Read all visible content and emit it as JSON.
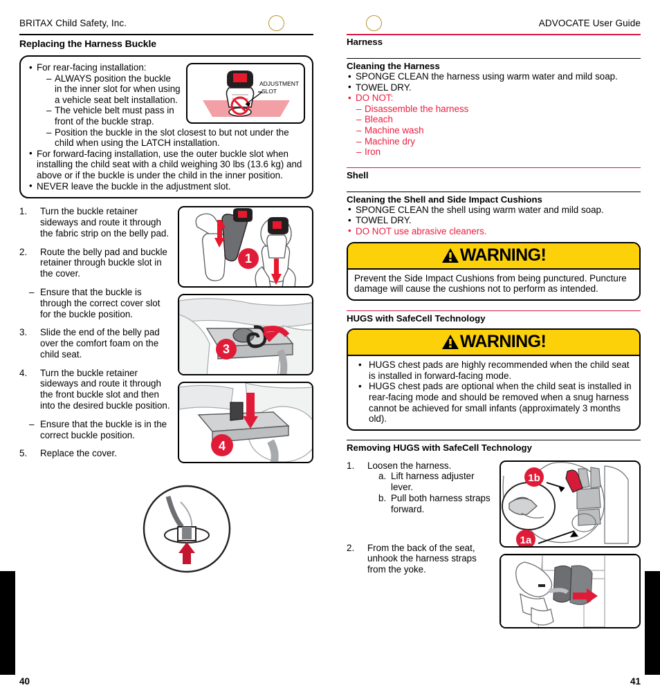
{
  "meta": {
    "accent_red": "#ed1b3c",
    "rule_red": "#d8173f",
    "warning_yellow": "#fcd10a",
    "badge_red": "#e01b38",
    "logo_gold": "#b8932c"
  },
  "left_page": {
    "running_head": "BRITAX Child Safety, Inc.",
    "logo_icon": "britax-circle-logo",
    "section_title": "Replacing the Harness Buckle",
    "folio": "40",
    "callout": {
      "items": [
        {
          "type": "bullet",
          "text": "For rear-facing installation:",
          "sub": [
            "ALWAYS position the buckle in the inner slot for when using a vehicle seat belt installation.",
            "The vehicle belt must pass in front of the buckle strap.",
            "Position the buckle in the slot closest to but not under the child when using the LATCH installation."
          ]
        },
        {
          "type": "bullet",
          "text": "For forward-facing installation, use the outer buckle slot when installing the child seat with a child weighing 30 lbs (13.6 kg) and above or if the buckle is under the child in the inner position.",
          "sub": []
        },
        {
          "type": "bullet",
          "text": "NEVER leave the buckle in the adjustment slot.",
          "sub": []
        }
      ],
      "figure": {
        "name": "adjustment-slot-figure",
        "label_line1": "ADJUSTMENT",
        "label_line2": "SLOT"
      }
    },
    "steps": [
      {
        "num": "1.",
        "text": "Turn the buckle retainer sideways and route it through the fabric strip on the belly pad."
      },
      {
        "num": "2.",
        "text": "Route the belly pad and buckle retainer through buckle slot in the cover."
      },
      {
        "num": "–",
        "text": "Ensure that the buckle is through the correct cover slot for the buckle position."
      },
      {
        "num": "3.",
        "text": "Slide the end of the belly pad over the comfort foam on the child seat."
      },
      {
        "num": "4.",
        "text": "Turn the buckle retainer sideways and route it through the front buckle slot and then into the desired buckle position."
      },
      {
        "num": "–",
        "text": "Ensure that the buckle is in the correct buckle position."
      },
      {
        "num": "5.",
        "text": "Replace the cover."
      }
    ],
    "figures": [
      {
        "name": "figure-step-1",
        "badge": "1"
      },
      {
        "name": "figure-step-3",
        "badge": "3"
      },
      {
        "name": "figure-step-4",
        "badge": "4"
      }
    ]
  },
  "right_page": {
    "running_head": "ADVOCATE User Guide",
    "logo_icon": "britax-circle-logo",
    "folio": "41",
    "harness": {
      "title": "Harness",
      "subsection": "Cleaning the Harness",
      "bullets": [
        {
          "text": "SPONGE CLEAN the harness using warm water and mild soap.",
          "color": "black"
        },
        {
          "text": "TOWEL DRY.",
          "color": "black"
        },
        {
          "text": "DO NOT:",
          "color": "red"
        }
      ],
      "donot_items": [
        "Disassemble the harness",
        "Bleach",
        "Machine wash",
        "Machine dry",
        "Iron"
      ]
    },
    "shell": {
      "title": "Shell",
      "subsection": "Cleaning the Shell and Side Impact Cushions",
      "bullets": [
        {
          "text": "SPONGE CLEAN the shell using warm water and mild soap.",
          "color": "black"
        },
        {
          "text": "TOWEL DRY.",
          "color": "black"
        },
        {
          "text": "DO NOT use abrasive cleaners.",
          "color": "red"
        }
      ],
      "warning": {
        "label": "WARNING!",
        "icon": "warning-triangle-icon",
        "body": "Prevent the Side Impact Cushions from being punctured. Puncture damage will cause the cushions not to perform as intended."
      }
    },
    "hugs": {
      "title": "HUGS with SafeCell Technology",
      "warning": {
        "label": "WARNING!",
        "icon": "warning-triangle-icon",
        "bullets": [
          "HUGS chest pads are highly recommended when the child seat is installed in forward-facing mode.",
          "HUGS chest pads are optional when the child seat is installed in rear-facing mode and should be removed when a snug harness cannot be achieved for small infants (approximately 3 months old)."
        ]
      }
    },
    "removing": {
      "title": "Removing HUGS with SafeCell Technology",
      "steps": [
        {
          "num": "1.",
          "text": "Loosen the harness.",
          "alpha": [
            {
              "key": "a.",
              "text": "Lift harness adjuster lever."
            },
            {
              "key": "b.",
              "text": "Pull both harness straps forward."
            }
          ]
        },
        {
          "num": "2.",
          "text": "From the back of the seat, unhook the harness straps from the yoke.",
          "alpha": []
        }
      ],
      "figures": [
        {
          "name": "figure-hugs-step-1",
          "badges": [
            "1b",
            "1a"
          ]
        },
        {
          "name": "figure-hugs-step-2",
          "badges": []
        }
      ]
    }
  }
}
